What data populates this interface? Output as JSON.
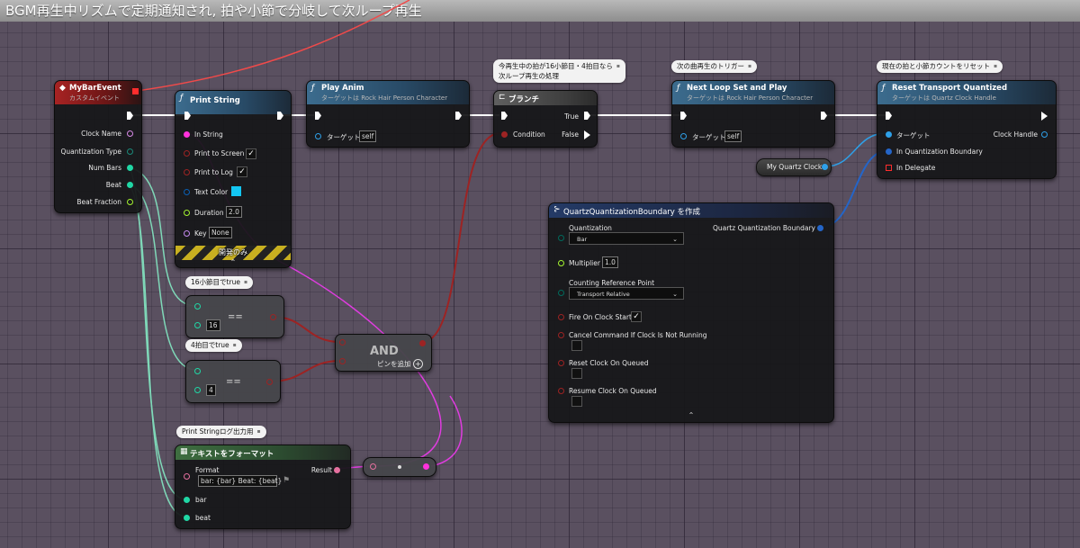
{
  "window": {
    "title": "BGM再生中リズムで定期通知され, 拍や小節で分岐して次ループ再生"
  },
  "colors": {
    "exec": "#ffffff",
    "string": "#ff31db",
    "int": "#20d7a5",
    "bool": "#9d2323",
    "float": "#a3f32f",
    "object": "#00a8f0",
    "struct": "#0a5fb4",
    "text": "#e5709f",
    "byte": "#006a5c",
    "delegate": "#ff2d2d"
  },
  "nodes": {
    "event": {
      "title": "MyBarEvent",
      "subtitle": "カスタムイベント",
      "pins": [
        "Clock Name",
        "Quantization Type",
        "Num Bars",
        "Beat",
        "Beat Fraction"
      ]
    },
    "print_string": {
      "title": "Print String",
      "pins": [
        "In String",
        "Print to Screen",
        "Print to Log",
        "Text Color",
        "Duration",
        "Key"
      ],
      "duration": "2.0",
      "key": "None",
      "dev_only": "開発のみ"
    },
    "play_anim": {
      "title": "Play Anim",
      "subtitle": "ターゲットは Rock Hair Person Character",
      "target_label": "ターゲット",
      "target_value": "self"
    },
    "branch": {
      "title": "ブランチ",
      "condition": "Condition",
      "true_label": "True",
      "false_label": "False"
    },
    "next_loop": {
      "title": "Next Loop Set and Play",
      "subtitle": "ターゲットは Rock Hair Person Character",
      "target_label": "ターゲット",
      "target_value": "self"
    },
    "reset_transport": {
      "title": "Reset Transport Quantized",
      "subtitle": "ターゲットは Quartz Clock Handle",
      "target_label": "ターゲット",
      "boundary_label": "In Quantization Boundary",
      "delegate_label": "In Delegate",
      "clock_handle": "Clock Handle"
    },
    "my_quartz_clock": {
      "label": "My Quartz Clock"
    },
    "eq16": {
      "value": "16",
      "op": "=="
    },
    "eq4": {
      "value": "4",
      "op": "=="
    },
    "and": {
      "title": "AND",
      "add_pin": "ピンを追加"
    },
    "format_text": {
      "title": "テキストをフォーマット",
      "format_label": "Format",
      "format_value": "bar: {bar} Beat: {beat}",
      "result": "Result",
      "pin_bar": "bar",
      "pin_beat": "beat"
    },
    "make_boundary": {
      "title": "QuartzQuantizationBoundary を作成",
      "output": "Quartz Quantization Boundary",
      "quantization_label": "Quantization",
      "quantization_value": "Bar",
      "multiplier_label": "Multiplier",
      "multiplier_value": "1.0",
      "counting_label": "Counting Reference Point",
      "counting_value": "Transport Relative",
      "fire_label": "Fire On Clock Start",
      "cancel_label": "Cancel Command If Clock Is Not Running",
      "reset_label": "Reset Clock On Queued",
      "resume_label": "Resume Clock On Queued"
    }
  },
  "comments": {
    "branch": [
      "今再生中の拍が16小節目・4拍目なら",
      "次ループ再生の処理"
    ],
    "next_loop": "次の曲再生のトリガー",
    "reset": "現在の拍と小節カウントをリセット",
    "eq16": "16小節目でtrue",
    "eq4": "4拍目でtrue",
    "format": "Print Stringログ出力用"
  }
}
